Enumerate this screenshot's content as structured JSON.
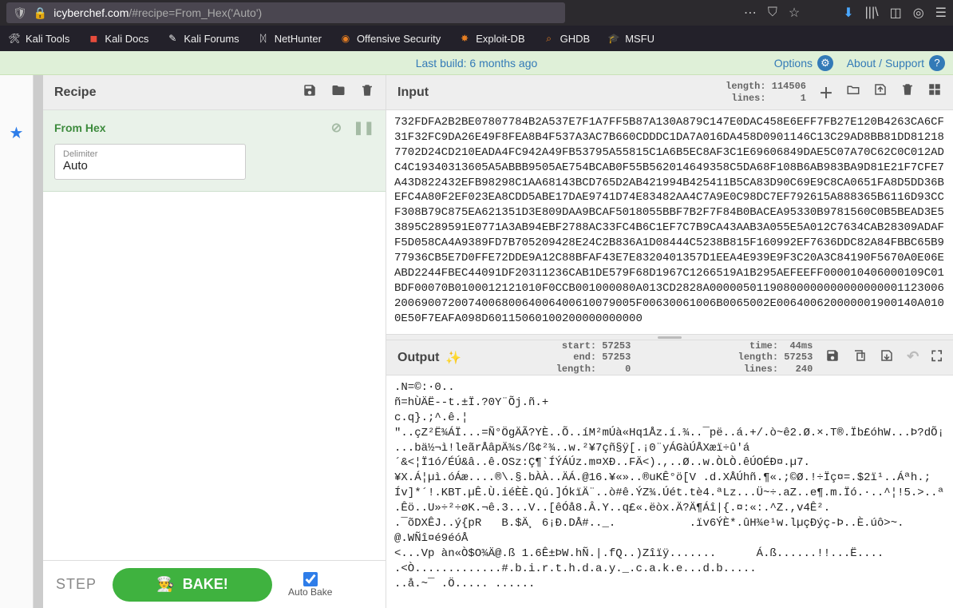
{
  "browser": {
    "url_domain": "icyberchef.com",
    "url_rest": "/#recipe=From_Hex('Auto')"
  },
  "bookmarks": [
    {
      "label": "Kali Tools",
      "icon": "🛠"
    },
    {
      "label": "Kali Docs",
      "icon": "📕"
    },
    {
      "label": "Kali Forums",
      "icon": "💬"
    },
    {
      "label": "NetHunter",
      "icon": "📡"
    },
    {
      "label": "Offensive Security",
      "icon": "🛡"
    },
    {
      "label": "Exploit-DB",
      "icon": "💥"
    },
    {
      "label": "GHDB",
      "icon": "🔍"
    },
    {
      "label": "MSFU",
      "icon": "🎓"
    }
  ],
  "banner": {
    "build": "Last build: 6 months ago",
    "options": "Options",
    "about": "About / Support"
  },
  "recipe": {
    "title": "Recipe",
    "op_name": "From Hex",
    "delimiter_label": "Delimiter",
    "delimiter_value": "Auto",
    "step": "STEP",
    "bake": "BAKE!",
    "autobake": "Auto Bake"
  },
  "input": {
    "title": "Input",
    "stats": "length: 114506\n lines:      1",
    "text": "732FDFA2B2BE07807784B2A537E7F1A7FF5B87A130A879C147E0DAC458E6EFF7FB27E120B4263CA6CF31F32FC9DA26E49F8FEA8B4F537A3AC7B660CDDDC1DA7A016DA458D0901146C13C29AD8BB81DD812187702D24CD210EADA4FC942A49FB53795A55815C1A6B5EC8AF3C1E69606849DAE5C07A70C62C0C012ADC4C19340313605A5ABBB9505AE754BCAB0F55B562014649358C5DA68F108B6AB983BA9D81E21F7CFE7A43D822432EFB98298C1AA68143BCD765D2AB421994B425411B5CA83D90C69E9C8CA0651FA8D5DD36BEFC4A80F2EF023EA8CDD5ABE17DAE9741D74E83482AA4C7A9E0C98DC7EF792615A888365B6116D93CCF308B79C875EA621351D3E809DAA9BCAF5018055BBF7B2F7F84B0BACEA95330B9781560C0B5BEAD3E53895C289591E0771A3AB94EBF2788AC33FC4B6C1EF7C7B9CA43AAB3A055E5A012C7634CAB28309ADAFF5D058CA4A9389FD7B705209428E24C2B836A1D08444C5238B815F160992EF7636DDC82A84FBBC65B977936CB5E7D0FFE72DDE9A12C88BFAF43E7E8320401357D1EEA4E939E9F3C20A3C84190F5670A0E06EABD2244FBEC44091DF20311236CAB1DE579F68D1967C1266519A1B295AEFEEFF000010406000109C01BDF00070B0100012121010F0CCB001000080A013CD2828A00000501190800000000000000001123006200690072007400680064006400610079005F00630061006B0065002E006400620000001900140A0100E50F7EAFA098D60115060100200000000000"
  },
  "output": {
    "title": "Output",
    "stats1": "start: 57253\n  end: 57253\nlength:     0",
    "stats2": "  time:  44ms\nlength: 57253\n lines:   240",
    "text": ".N=©:·0..\nñ=hÙÄË--t.±Ï.?0Y¨Õj.ñ.+\nc.q}.;^.ê.¦\n\"..çZ²Ë¾ÁÏ...=Ñ°ÖgÄÃ?YÈ..Õ..íM²mÚà«Hq1Åz.í.¾..¯pë..á.+/.ò~ê2.Ø.×.T®.Ïb£óhW...Þ?dÕ¡\n...bä½¬ì!leãrÅâpÄ¾s/ß¢²¾..w.²¥7çñ§ÿ[.¡0¨yÁGàÚÅXæï÷û'á\n´&<¦Ï1ó/ÉÚ&â..ê.OSz:Ç¶`ÍÝÁÚz.m¤XÐ..FÄ<).,..Ø..w.ÒLÒ.êÚOÉÐ¤.µ7.\n¥X.Á¦µì.óÁæ....®\\.§.bÀÀ..ÄÁ.@16.¥«»..®uKÊ°ö[V .d.XÅÚhñ.¶«.;©Ø.!÷Ïç¤=.$2ï¹..Áªh.;\nÍv]*´!.KBT.µÊ.Ù.iéÈÈ.Qú.]ÓkïÄ¨..ò#ê.ÝZ¾.Úét.tè4.ªLz...Ü~÷.aZ..e¶.m.Ïó.·..^¦!5.>..ª\n.Êö..U»÷²÷øK.¬ê.3...V..[êÓå8.Â.Y..q£«.ëòx.Ä?Ä¶Áî|{.¤:«:.^Z.,v4Ê².\n.¯õDXÊJ..ý{pR   B.$Ä¸ 6¡Ð.DÅ#.._.           .ïv6ÝÈ*.ûH¾e¹w.lµçÐýç-Þ..È.úô>~.\n@.WÑî¤é9éóÅ\n<...Vp àn«Ò$O¾Ä@.ß 1.6Ê±ÞW.hÑ.|.fQ..)Zîïÿ.......      Á.ß......!!...Ë....\n.<Ò.............#.b.i.r.t.h.d.a.y._.c.a.k.e...d.b.....\n..å.~¯ .Ö..... ......"
  }
}
